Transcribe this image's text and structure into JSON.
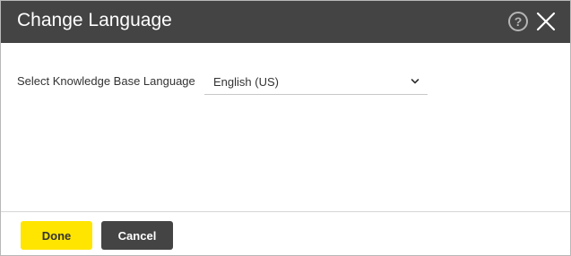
{
  "dialog": {
    "title": "Change Language",
    "help_icon": "help-circle-icon",
    "close_icon": "close-icon"
  },
  "form": {
    "language_label": "Select Knowledge Base Language",
    "language_value": "English (US)",
    "dropdown_icon": "chevron-down-icon"
  },
  "footer": {
    "done_label": "Done",
    "cancel_label": "Cancel"
  },
  "colors": {
    "titlebar_bg": "#444444",
    "primary_button": "#ffe500",
    "secondary_button": "#444444"
  }
}
